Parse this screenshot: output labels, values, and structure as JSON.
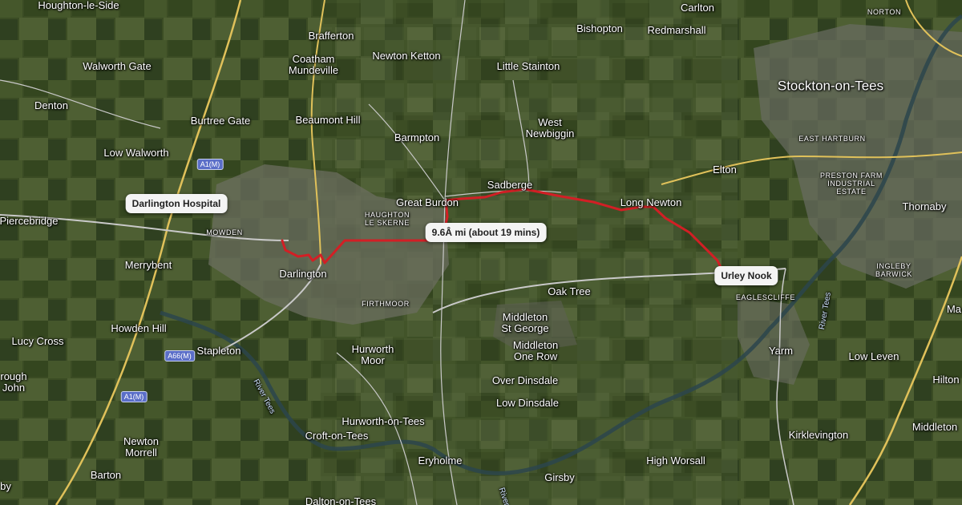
{
  "colors": {
    "route": "#d21f25",
    "road_major": "#e0c15a",
    "road_minor": "#c8c8c8",
    "river": "#2f4a52",
    "field_dark": "#31411f",
    "field_mid": "#4a5a30",
    "urban": "#6e6e62"
  },
  "route": {
    "origin": "Darlington Hospital",
    "destination": "Urley Nook",
    "summary": "9.6Â mi (about 19 mins)"
  },
  "places": [
    {
      "name": "Houghton-le-Side",
      "kind": "place"
    },
    {
      "name": "Brafferton",
      "kind": "place"
    },
    {
      "name": "Bishopton",
      "kind": "place"
    },
    {
      "name": "Carlton",
      "kind": "place"
    },
    {
      "name": "Redmarshall",
      "kind": "place"
    },
    {
      "name": "NORTON",
      "kind": "district"
    },
    {
      "name": "Walworth Gate",
      "kind": "place"
    },
    {
      "name": "Coatham\nMundeville",
      "kind": "place"
    },
    {
      "name": "Newton Ketton",
      "kind": "place"
    },
    {
      "name": "Little Stainton",
      "kind": "place"
    },
    {
      "name": "Stockton-on-Tees",
      "kind": "city"
    },
    {
      "name": "Denton",
      "kind": "place"
    },
    {
      "name": "Burtree Gate",
      "kind": "place"
    },
    {
      "name": "Beaumont Hill",
      "kind": "place"
    },
    {
      "name": "West\nNewbiggin",
      "kind": "place"
    },
    {
      "name": "EAST HARTBURN",
      "kind": "district"
    },
    {
      "name": "Barmpton",
      "kind": "place"
    },
    {
      "name": "Low Walworth",
      "kind": "place"
    },
    {
      "name": "Elton",
      "kind": "place"
    },
    {
      "name": "PRESTON FARM\nINDUSTRIAL\nESTATE",
      "kind": "district"
    },
    {
      "name": "Sadberge",
      "kind": "place"
    },
    {
      "name": "Great Burdon",
      "kind": "place"
    },
    {
      "name": "Long Newton",
      "kind": "place"
    },
    {
      "name": "Thornaby",
      "kind": "place"
    },
    {
      "name": "HAUGHTON\nLE SKERNE",
      "kind": "district"
    },
    {
      "name": "Piercebridge",
      "kind": "place"
    },
    {
      "name": "MOWDEN",
      "kind": "district"
    },
    {
      "name": "Merrybent",
      "kind": "place"
    },
    {
      "name": "Darlington",
      "kind": "place"
    },
    {
      "name": "INGLEBY\nBARWICK",
      "kind": "district"
    },
    {
      "name": "Oak Tree",
      "kind": "place"
    },
    {
      "name": "EAGLESCLIFFE",
      "kind": "district"
    },
    {
      "name": "FIRTHMOOR",
      "kind": "district"
    },
    {
      "name": "Middleton\nSt George",
      "kind": "place"
    },
    {
      "name": "Ma",
      "kind": "place"
    },
    {
      "name": "Howden Hill",
      "kind": "place"
    },
    {
      "name": "Lucy Cross",
      "kind": "place"
    },
    {
      "name": "Middleton\nOne Row",
      "kind": "place"
    },
    {
      "name": "Stapleton",
      "kind": "place"
    },
    {
      "name": "Hurworth\nMoor",
      "kind": "place"
    },
    {
      "name": "Yarm",
      "kind": "place"
    },
    {
      "name": "Low Leven",
      "kind": "place"
    },
    {
      "name": "rough\nJohn",
      "kind": "place"
    },
    {
      "name": "Hilton",
      "kind": "place"
    },
    {
      "name": "Over Dinsdale",
      "kind": "place"
    },
    {
      "name": "Low Dinsdale",
      "kind": "place"
    },
    {
      "name": "Middleton",
      "kind": "place"
    },
    {
      "name": "Hurworth-on-Tees",
      "kind": "place"
    },
    {
      "name": "Croft-on-Tees",
      "kind": "place"
    },
    {
      "name": "Kirklevington",
      "kind": "place"
    },
    {
      "name": "Newton\nMorrell",
      "kind": "place"
    },
    {
      "name": "Eryholme",
      "kind": "place"
    },
    {
      "name": "High Worsall",
      "kind": "place"
    },
    {
      "name": "Barton",
      "kind": "place"
    },
    {
      "name": "Girsby",
      "kind": "place"
    },
    {
      "name": "Dalton-on-Tees",
      "kind": "place"
    },
    {
      "name": "by",
      "kind": "place"
    }
  ],
  "rivers": [
    {
      "name": "River Tees"
    },
    {
      "name": "River Tees"
    },
    {
      "name": "River"
    }
  ],
  "road_shields": [
    "A1(M)",
    "A66(M)",
    "A1(M)"
  ]
}
